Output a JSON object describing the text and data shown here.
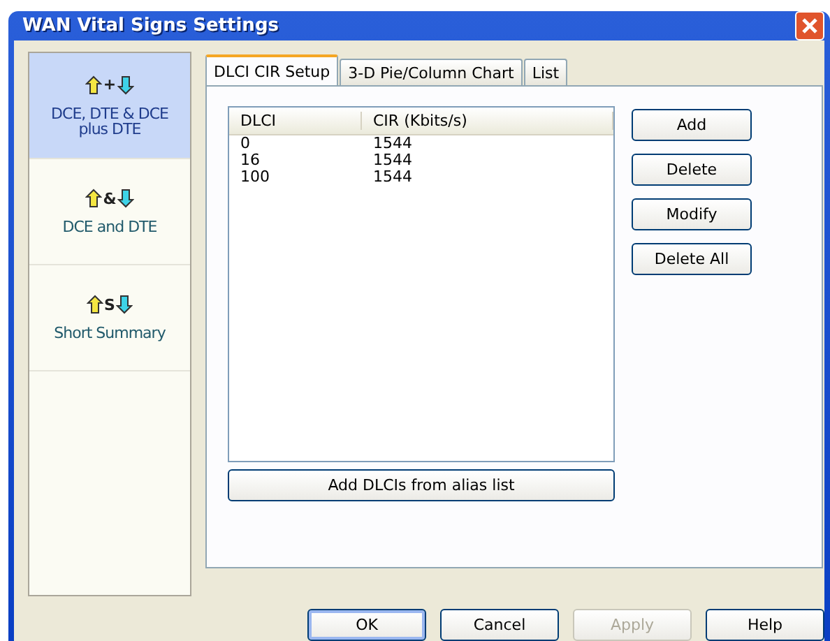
{
  "window": {
    "title": "WAN Vital Signs Settings"
  },
  "sidebar": {
    "items": [
      {
        "symbol": "+",
        "label": "DCE, DTE & DCE plus DTE",
        "selected": true
      },
      {
        "symbol": "&",
        "label": "DCE and DTE",
        "selected": false
      },
      {
        "symbol": "S",
        "label": "Short Summary",
        "selected": false
      }
    ]
  },
  "tabs": [
    {
      "label": "DLCI CIR Setup",
      "selected": true
    },
    {
      "label": "3-D Pie/Column Chart",
      "selected": false
    },
    {
      "label": "List",
      "selected": false
    }
  ],
  "table": {
    "columns": [
      "DLCI",
      "CIR (Kbits/s)"
    ],
    "rows": [
      [
        "0",
        "1544"
      ],
      [
        "16",
        "1544"
      ],
      [
        "100",
        "1544"
      ]
    ]
  },
  "side_buttons": [
    "Add",
    "Delete",
    "Modify",
    "Delete All"
  ],
  "add_from_alias_button": "Add DLCIs from alias list",
  "buttons": [
    {
      "label": "OK",
      "disabled": false,
      "default": true
    },
    {
      "label": "Cancel",
      "disabled": false,
      "default": false
    },
    {
      "label": "Apply",
      "disabled": true,
      "default": false
    },
    {
      "label": "Help",
      "disabled": false,
      "default": false
    }
  ]
}
